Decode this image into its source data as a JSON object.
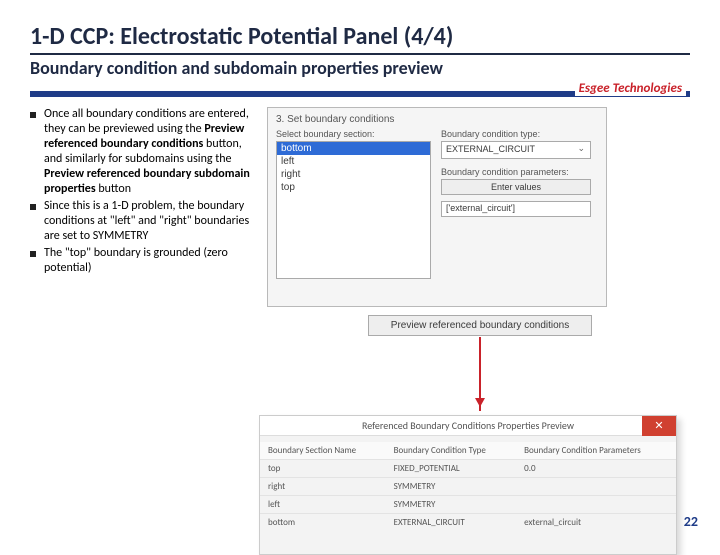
{
  "header": {
    "title": "1-D CCP: Electrostatic Potential Panel (4/4)",
    "subtitle": "Boundary condition and subdomain properties preview",
    "brand": "Esgee Technologies"
  },
  "bullets": [
    {
      "pre": "Once all boundary conditions are entered, they can be previewed using the ",
      "b1": "Preview referenced boundary conditions",
      "mid": " button, and similarly for subdomains using the ",
      "b2": "Preview referenced boundary subdomain properties",
      "post": " button"
    },
    {
      "text": "Since this is a 1-D problem, the boundary conditions at \"left\" and \"right\" boundaries are set to SYMMETRY"
    },
    {
      "text": "The \"top\" boundary is grounded (zero potential)"
    }
  ],
  "panel_top": {
    "step": "3. Set boundary conditions",
    "select_label": "Select boundary section:",
    "options": [
      "bottom",
      "left",
      "right",
      "top"
    ],
    "bc_type_label": "Boundary condition type:",
    "bc_type_value": "EXTERNAL_CIRCUIT",
    "bc_param_label": "Boundary condition parameters:",
    "enter_values": "Enter values",
    "param_field": "['external_circuit']",
    "preview_btn": "Preview referenced boundary conditions"
  },
  "dialog": {
    "title": "Referenced Boundary Conditions Properties Preview",
    "headers": [
      "Boundary Section Name",
      "Boundary Condition Type",
      "Boundary Condition Parameters"
    ],
    "rows": [
      [
        "top",
        "FIXED_POTENTIAL",
        "0.0"
      ],
      [
        "right",
        "SYMMETRY",
        ""
      ],
      [
        "left",
        "SYMMETRY",
        ""
      ],
      [
        "bottom",
        "EXTERNAL_CIRCUIT",
        "external_circuit"
      ]
    ]
  },
  "page_number": "22"
}
